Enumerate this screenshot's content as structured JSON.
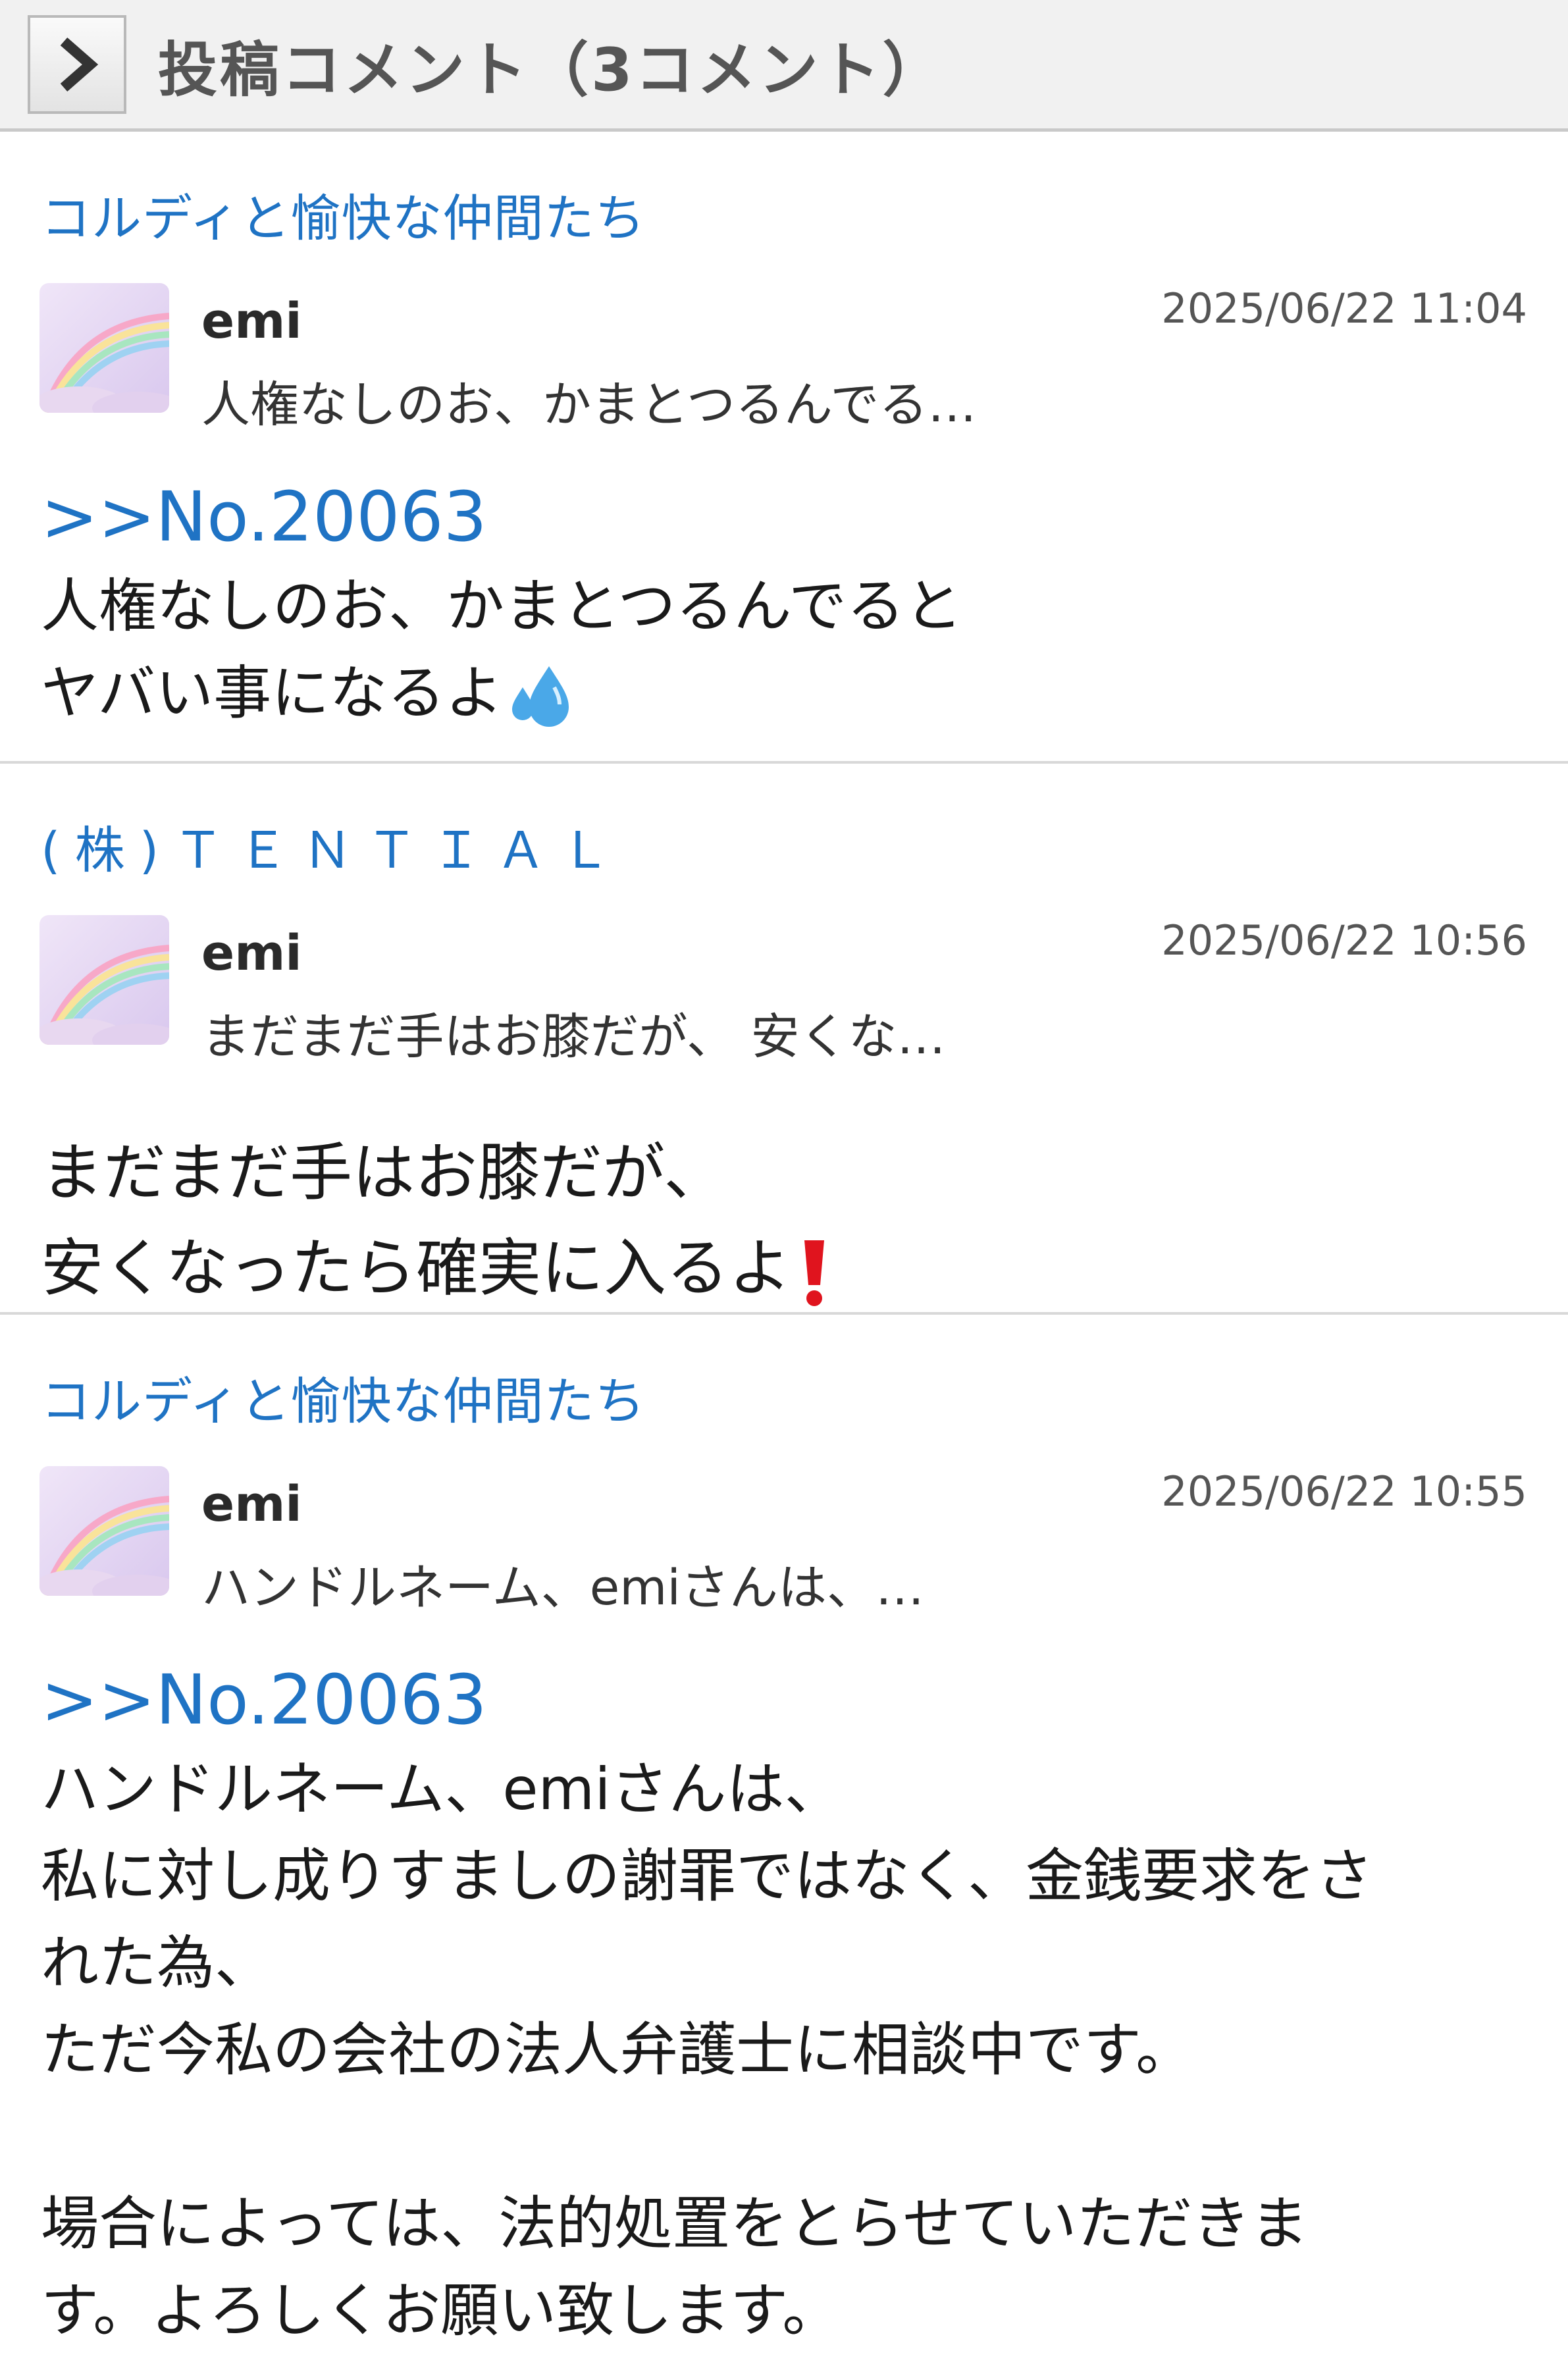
{
  "header": {
    "title": "投稿コメント（3コメント）",
    "back_icon": "chevron-right-icon"
  },
  "comments": [
    {
      "topic": "コルディと愉快な仲間たち",
      "author": "emi",
      "timestamp": "2025/06/22 11:04",
      "preview": "人権なしのお、かまとつるんでる…",
      "ref": ">>No.20063",
      "lines": [
        "人権なしのお、かまとつるんでると",
        "ヤバい事になるよ"
      ],
      "emoji": "sweat-droplets-icon"
    },
    {
      "topic": "(株)ＴＥＮＴＩＡＬ",
      "author": "emi",
      "timestamp": "2025/06/22 10:56",
      "preview": "まだまだ手はお膝だが、 安くな…",
      "lines": [
        "まだまだ手はお膝だが、",
        "安くなったら確実に入るよ"
      ],
      "emoji": "exclamation-mark-icon"
    },
    {
      "topic": "コルディと愉快な仲間たち",
      "author": "emi",
      "timestamp": "2025/06/22 10:55",
      "preview": "ハンドルネーム、emiさんは、…",
      "ref": ">>No.20063",
      "lines": [
        "ハンドルネーム、emiさんは、",
        "私に対し成りすましの謝罪ではなく、金銭要求をさ",
        "れた為、",
        "ただ今私の会社の法人弁護士に相談中です。",
        "",
        "場合によっては、法的処置をとらせていただきま",
        "す。よろしくお願い致します。"
      ]
    }
  ],
  "colors": {
    "link_blue": "#1f73c4",
    "header_bg": "#f1f1f1",
    "divider": "#d8d8d8"
  }
}
